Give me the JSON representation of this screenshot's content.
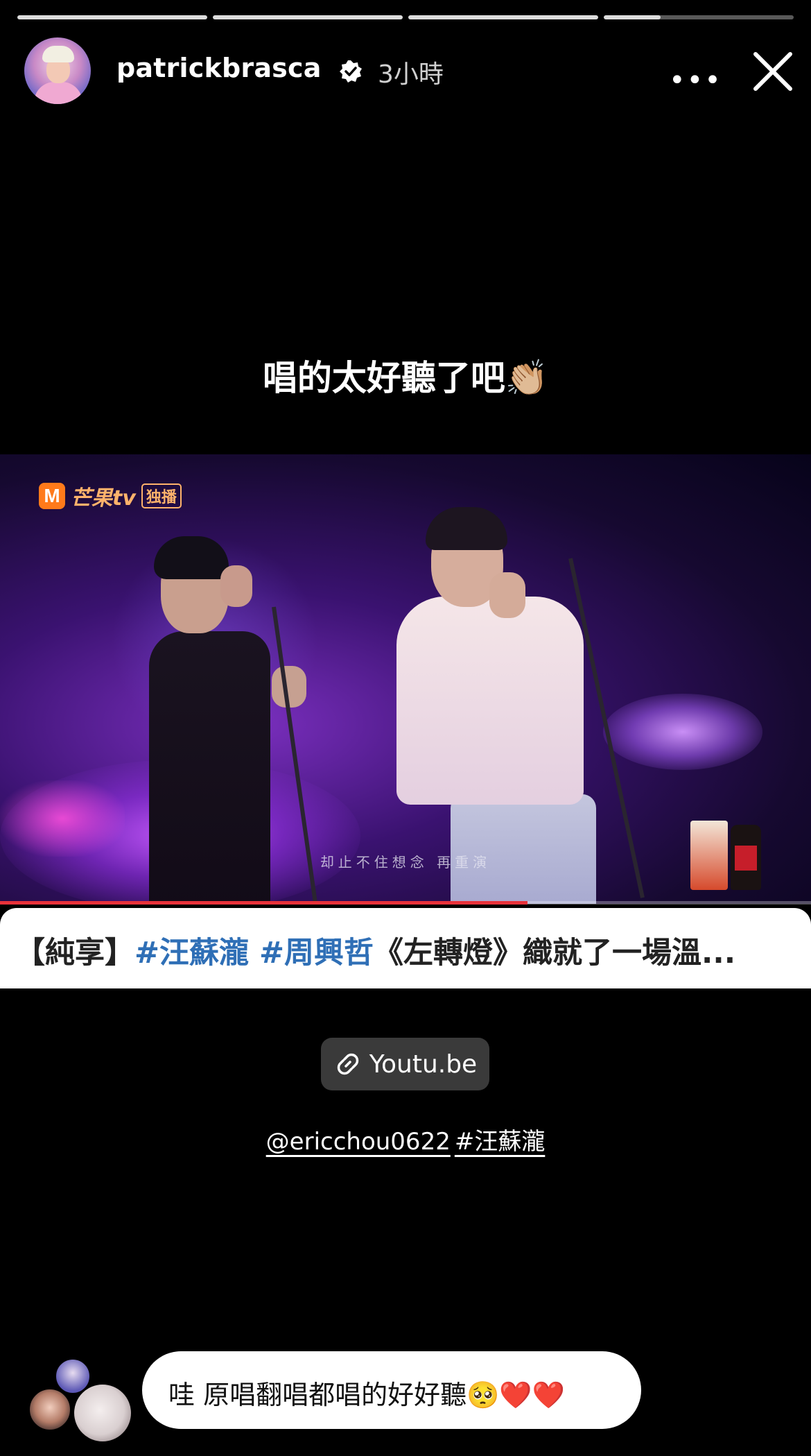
{
  "story": {
    "segments": [
      {
        "progress": 1.0
      },
      {
        "progress": 1.0
      },
      {
        "progress": 1.0
      },
      {
        "progress": 0.3
      }
    ]
  },
  "header": {
    "username": "patrickbrasca",
    "time": "3小時",
    "more_glyph": "•••",
    "icons": {
      "verified": "verified-badge-icon",
      "more": "more-options-icon",
      "close": "close-icon"
    }
  },
  "caption": "唱的太好聽了吧👏🏼",
  "video": {
    "logo_letter": "M",
    "logo_brand": "芒果tv",
    "logo_exclusive": "独播",
    "subtitle": "却止不住想念 再重演",
    "progress": 0.65,
    "progress_color": "#e8323a",
    "title_prefix": "【純享】",
    "title_tag1": "#汪蘇瀧",
    "title_tag2": "#周興哲",
    "title_rest": "《左轉燈》織就了一場溫...",
    "tag_color": "#2f6fb6"
  },
  "link_sticker": {
    "label": "Youtu.be",
    "icon": "link-icon"
  },
  "mentions": {
    "user": "@ericchou0622",
    "hashtag": "#汪蘇瀧"
  },
  "reply": {
    "text": "哇 原唱翻唱都唱的好好聽🥺❤️❤️"
  }
}
